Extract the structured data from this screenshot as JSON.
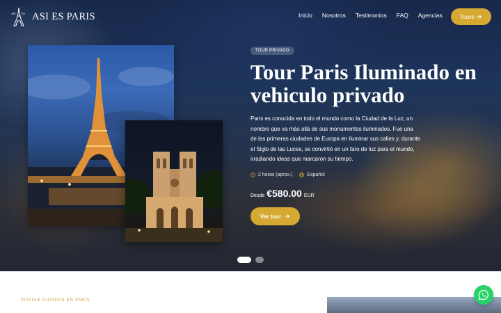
{
  "brand": {
    "logo_text": "ASI ES PARIS",
    "icon": "eiffel-logo-icon",
    "color": "#d6a932"
  },
  "nav": {
    "links": [
      "Inicio",
      "Nosotros",
      "Testimonios",
      "FAQ",
      "Agencias"
    ],
    "tours_label": "Tours",
    "tours_icon": "arrow-right-icon"
  },
  "hero": {
    "badge": "TOUR PRIVADO",
    "title": "Tour Paris Iluminado en vehiculo privado",
    "description": "Paris es conocida en todo el mundo como la Ciudad de la Luz, un nombre que va más allá de sus monumentos iluminados. Fue una de las primeras ciudades de Europa en iluminar sus calles y, durante el Siglo de las Luces, se convirtió en un faro de luz para el mundo, irradiando ideas que marcaron su tiempo.",
    "duration": "2 horas (aprox.)",
    "duration_icon": "clock-icon",
    "language": "Español",
    "language_icon": "globe-icon",
    "price_label": "Desde",
    "price": "€580.00",
    "currency": "EUR",
    "cta_label": "Ver tour",
    "cta_icon": "arrow-right-icon",
    "slides": {
      "total": 2,
      "active": 1
    }
  },
  "next_section": {
    "tag": "VISITAS GUIADAS EN PARÍS"
  },
  "whatsapp_icon": "whatsapp-icon"
}
